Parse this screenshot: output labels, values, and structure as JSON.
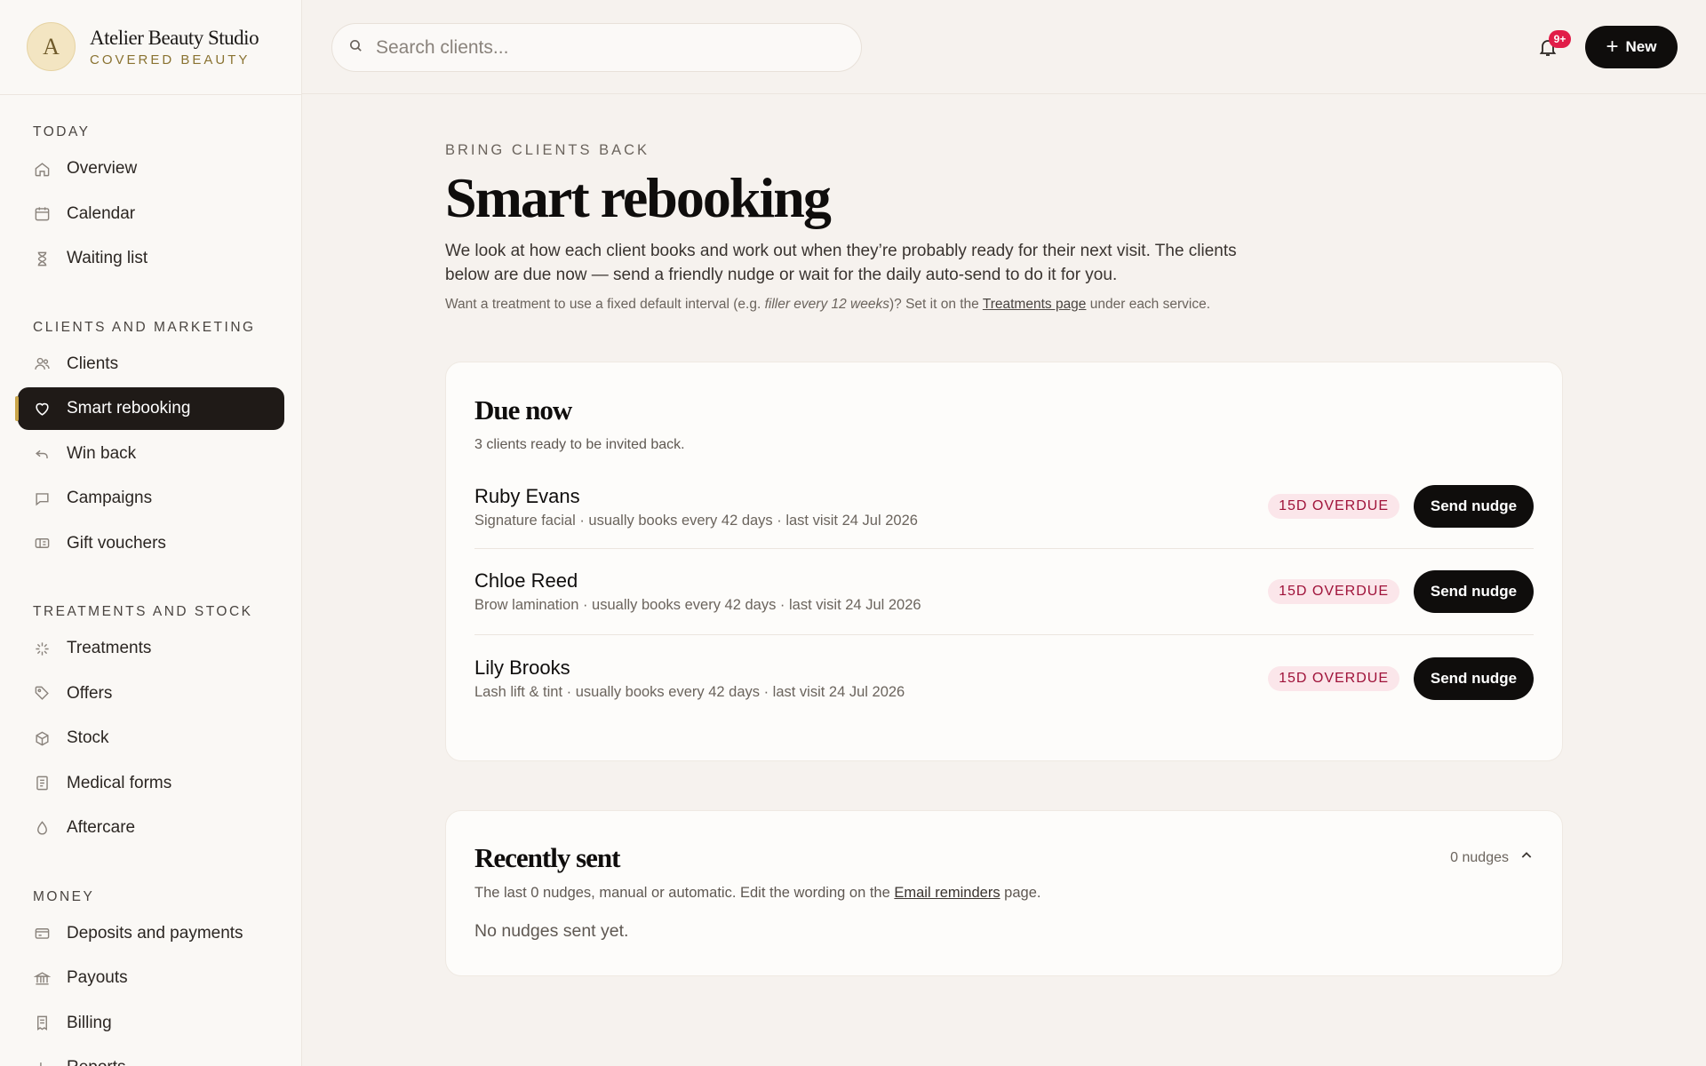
{
  "brand": {
    "initial": "A",
    "name": "Atelier Beauty Studio",
    "subtitle": "COVERED BEAUTY"
  },
  "search": {
    "placeholder": "Search clients..."
  },
  "header": {
    "notifications_badge": "9+",
    "new_label": "New"
  },
  "sidebar": {
    "sections": [
      {
        "title": "TODAY",
        "items": [
          {
            "label": "Overview",
            "icon": "home-icon"
          },
          {
            "label": "Calendar",
            "icon": "calendar-icon"
          },
          {
            "label": "Waiting list",
            "icon": "hourglass-icon"
          }
        ]
      },
      {
        "title": "CLIENTS AND MARKETING",
        "items": [
          {
            "label": "Clients",
            "icon": "users-icon"
          },
          {
            "label": "Smart rebooking",
            "icon": "heart-icon",
            "active": true
          },
          {
            "label": "Win back",
            "icon": "undo-arrow-icon"
          },
          {
            "label": "Campaigns",
            "icon": "chat-bubble-icon"
          },
          {
            "label": "Gift vouchers",
            "icon": "ticket-icon"
          }
        ]
      },
      {
        "title": "TREATMENTS AND STOCK",
        "items": [
          {
            "label": "Treatments",
            "icon": "sparkle-icon"
          },
          {
            "label": "Offers",
            "icon": "tag-icon"
          },
          {
            "label": "Stock",
            "icon": "box-icon"
          },
          {
            "label": "Medical forms",
            "icon": "document-icon"
          },
          {
            "label": "Aftercare",
            "icon": "droplet-icon"
          }
        ]
      },
      {
        "title": "MONEY",
        "items": [
          {
            "label": "Deposits and payments",
            "icon": "credit-card-icon"
          },
          {
            "label": "Payouts",
            "icon": "bank-icon"
          },
          {
            "label": "Billing",
            "icon": "receipt-icon"
          },
          {
            "label": "Reports",
            "icon": "chart-icon"
          }
        ]
      }
    ]
  },
  "page": {
    "eyebrow": "BRING CLIENTS BACK",
    "title": "Smart rebooking",
    "lead": "We look at how each client books and work out when they’re probably ready for their next visit. The clients below are due now — send a friendly nudge or wait for the daily auto-send to do it for you.",
    "note_pre": "Want a treatment to use a fixed default interval (e.g. ",
    "note_em": "filler every 12 weeks",
    "note_mid": ")? Set it on the ",
    "note_link": "Treatments page",
    "note_post": " under each service."
  },
  "due_now": {
    "title": "Due now",
    "subtitle": "3 clients ready to be invited back.",
    "button_label": "Send nudge",
    "clients": [
      {
        "name": "Ruby Evans",
        "meta": "Signature facial · usually books every 42 days · last visit 24 Jul 2026",
        "status": "15D OVERDUE"
      },
      {
        "name": "Chloe Reed",
        "meta": "Brow lamination · usually books every 42 days · last visit 24 Jul 2026",
        "status": "15D OVERDUE"
      },
      {
        "name": "Lily Brooks",
        "meta": "Lash lift & tint · usually books every 42 days · last visit 24 Jul 2026",
        "status": "15D OVERDUE"
      }
    ]
  },
  "recently_sent": {
    "title": "Recently sent",
    "count_label": "0 nudges",
    "sub_pre": "The last 0 nudges, manual or automatic. Edit the wording on the ",
    "sub_link": "Email reminders",
    "sub_post": " page.",
    "empty": "No nudges sent yet."
  },
  "colors": {
    "accent": "#0f0d0c",
    "overdue_bg": "#fbe6ea",
    "overdue_text": "#9f1239",
    "brand_gold": "#8a7332",
    "notification": "#e11d48"
  }
}
